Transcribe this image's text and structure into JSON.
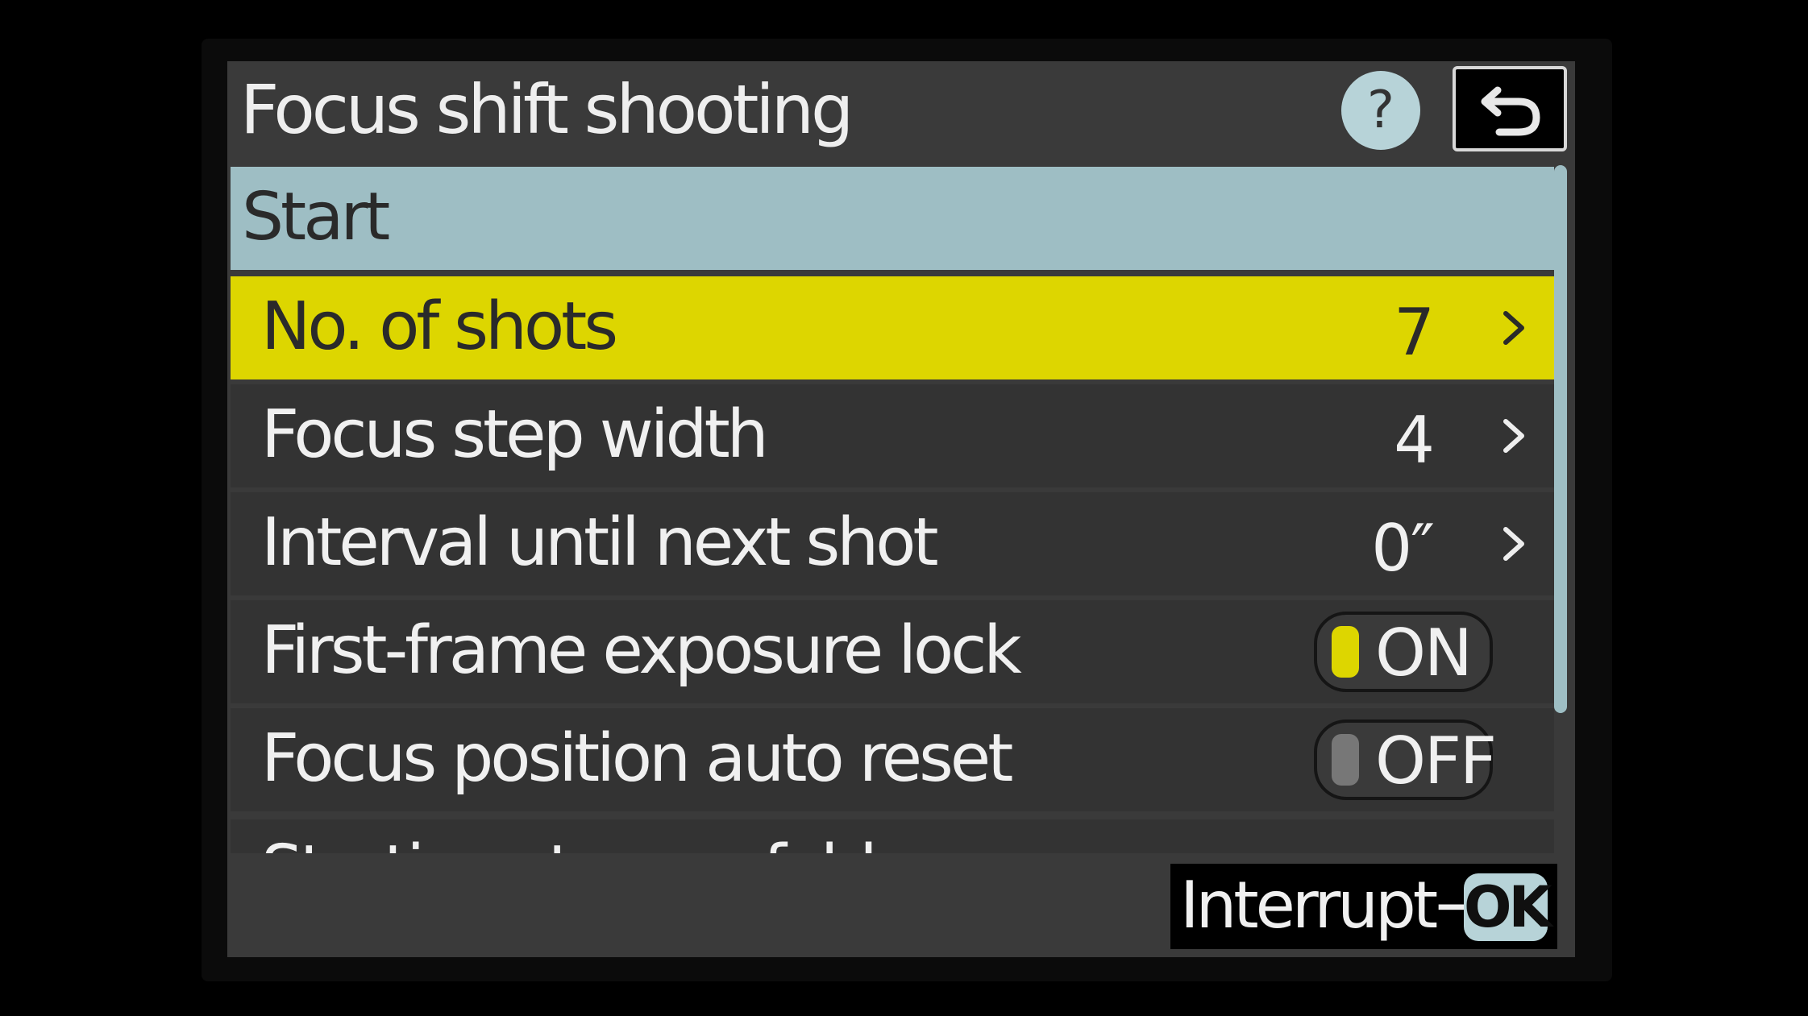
{
  "header": {
    "title": "Focus shift shooting",
    "help_glyph": "?",
    "help_icon": "help-icon",
    "back_icon": "back-return-icon"
  },
  "menu": {
    "items": [
      {
        "label": "Start"
      },
      {
        "label": "No. of shots",
        "value": "7"
      },
      {
        "label": "Focus step width",
        "value": "4"
      },
      {
        "label": "Interval until next shot",
        "value": "0″"
      },
      {
        "label": "First-frame exposure lock",
        "toggle": "ON"
      },
      {
        "label": "Focus position auto reset",
        "toggle": "OFF"
      },
      {
        "label": "Starting storage folder"
      }
    ]
  },
  "footer": {
    "interrupt_label": "Interrupt→",
    "ok_label": "OK"
  },
  "colors": {
    "selected_row": "#ddd600",
    "start_row": "#9ebec4",
    "row_bg": "#333333",
    "toggle_on_knob": "#ddd600",
    "toggle_off_knob": "#777777",
    "accent_blue": "#b7d3d8"
  }
}
